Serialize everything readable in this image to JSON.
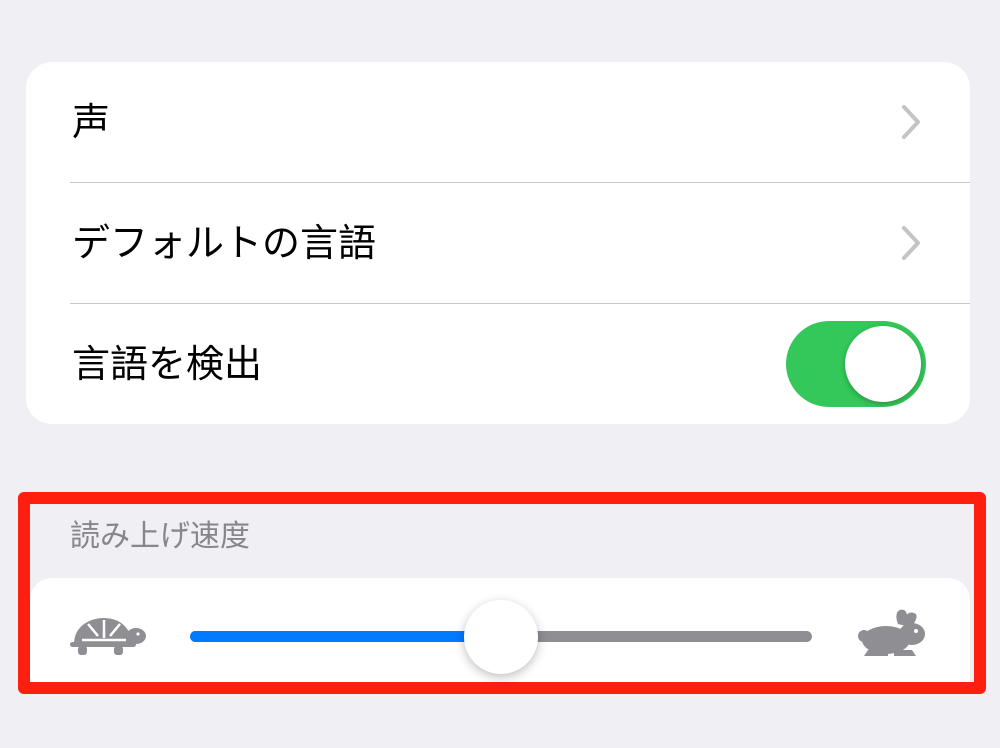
{
  "settings_group": {
    "rows": [
      {
        "label": "声",
        "accessory": "chevron-right-icon"
      },
      {
        "label": "デフォルトの言語",
        "accessory": "chevron-right-icon"
      },
      {
        "label": "言語を検出",
        "accessory": "toggle",
        "toggle_on": true
      }
    ]
  },
  "speech_rate": {
    "header": "読み上げ速度",
    "slow_icon": "turtle-icon",
    "fast_icon": "rabbit-icon",
    "value_fraction": 0.5
  },
  "colors": {
    "background": "#efeff4",
    "toggle_on": "#34c759",
    "slider_fill": "#007aff",
    "slider_track": "#8e8e93",
    "highlight_border": "#ff1f0f",
    "chevron": "#c4c4c6",
    "icon_gray": "#8e8e93"
  }
}
